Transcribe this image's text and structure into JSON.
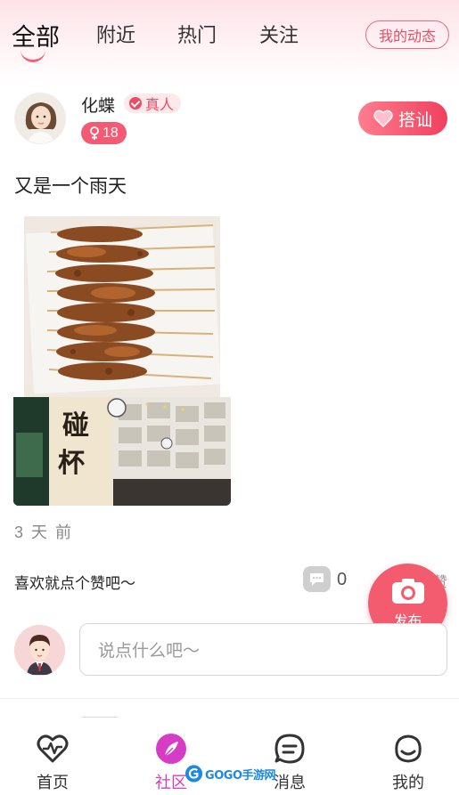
{
  "header": {
    "tabs": [
      "全部",
      "附近",
      "热门",
      "关注"
    ],
    "active_tab": "全部",
    "my_activity_label": "我的动态"
  },
  "post": {
    "username": "化蝶",
    "real_badge": "真人",
    "age": "18",
    "chat_label": "搭讪",
    "text": "又是一个雨天",
    "time": "3 天 前",
    "like_hint": "喜欢就点个赞吧～",
    "comment_count": "0",
    "like_label_peek": "赞"
  },
  "publish_label": "发布",
  "comment_input": {
    "placeholder": "说点什么吧～"
  },
  "bottom_nav": [
    {
      "label": "首页",
      "icon": "heart-pulse-icon"
    },
    {
      "label": "社区",
      "icon": "feather-icon"
    },
    {
      "label": "消息",
      "icon": "message-icon"
    },
    {
      "label": "我的",
      "icon": "profile-icon"
    }
  ],
  "watermark": "GOGO手游网",
  "colors": {
    "accent": "#f25c6e",
    "community_active": "#d63cc6",
    "header_pink": "#fde3e8"
  }
}
